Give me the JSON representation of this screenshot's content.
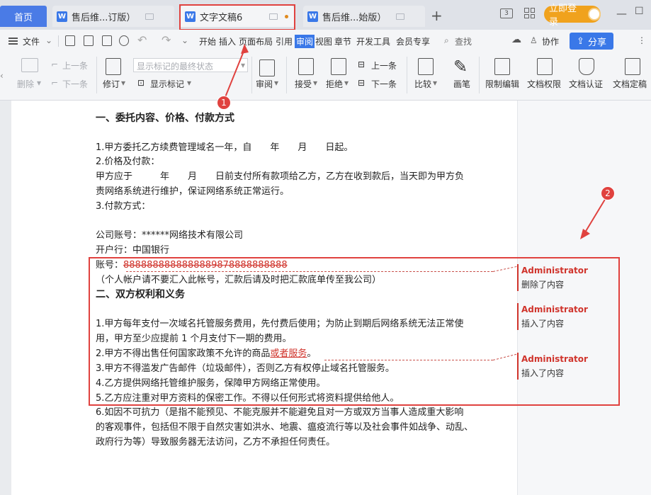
{
  "tabs": {
    "home": "首页",
    "doc1": "售后维...订版）",
    "doc2": "文字文稿6",
    "doc3": "售后维...始版）"
  },
  "titlebar": {
    "login": "立即登录"
  },
  "menu": {
    "file": "文件",
    "items": [
      "开始",
      "插入",
      "页面布局",
      "引用",
      "审阅",
      "视图",
      "章节",
      "开发工具",
      "会员专享"
    ],
    "search": "查找",
    "collab": "协作",
    "share": "分享"
  },
  "ribbon": {
    "delete": "删除",
    "prev_comment": "上一条",
    "next_comment": "下一条",
    "revise": "修订",
    "markup_select": "显示标记的最终状态",
    "show_markup": "显示标记",
    "review": "审阅",
    "accept": "接受",
    "reject": "拒绝",
    "prev_change": "上一条",
    "next_change": "下一条",
    "compare": "比较",
    "ink": "画笔",
    "restrict": "限制编辑",
    "permission": "文档权限",
    "certify": "文档认证",
    "finalize": "文档定稿"
  },
  "document": {
    "h1": "一、委托内容、价格、付款方式",
    "p1": "1.甲方委托乙方续费管理域名一年，自　　年　　月　　日起。",
    "p2": "2.价格及付款：",
    "p3": "甲方应于　　　年　　月　　日前支付所有款项给乙方，乙方在收到款后，当天即为甲方负",
    "p4": "责网络系统进行维护，保证网络系统正常运行。",
    "p5": "3.付款方式：",
    "p6": "公司账号：******网络技术有限公司",
    "p7": "开户行：中国银行",
    "p8_label": "账号：",
    "p8_deleted": "8888888888888889878888888888",
    "p9": "（个人帐户请不要汇入此帐号，汇款后请及时把汇款底单传至我公司）",
    "h2": "二、双方权利和义务",
    "p10": "1.甲方每年支付一次域名托管服务费用，先付费后使用；为防止到期后网络系统无法正常使",
    "p11": "用，甲方至少应提前 1 个月支付下一期的费用。",
    "p12_pre": "2.甲方不得出售任何国家政策不允许的商品",
    "p12_ins": "或者服务",
    "p12_post": "。",
    "p13": "3.甲方不得滥发广告邮件（垃圾邮件），否则乙方有权停止域名托管服务。",
    "p14": "4.乙方提供网络托管维护服务，保障甲方网络正常使用。",
    "p15": "5.乙方应注重对甲方资料的保密工作。不得以任何形式将资料提供给他人。",
    "p16": "6.如因不可抗力（是指不能预见、不能克服并不能避免且对一方或双方当事人造成重大影响",
    "p17": "的客观事件，包括但不限于自然灾害如洪水、地震、瘟疫流行等以及社会事件如战争、动乱、",
    "p18": "政府行为等）导致服务器无法访问，乙方不承担任何责任。"
  },
  "comments": [
    {
      "author": "Administrator",
      "text": "删除了内容"
    },
    {
      "author": "Administrator",
      "text": "插入了内容"
    },
    {
      "author": "Administrator",
      "text": "插入了内容"
    }
  ],
  "annotations": {
    "badge1": "1",
    "badge2": "2"
  },
  "colors": {
    "accent": "#3a78e8",
    "revision": "#d0342c",
    "highlight": "#e0423f",
    "login": "#f0a21d"
  }
}
